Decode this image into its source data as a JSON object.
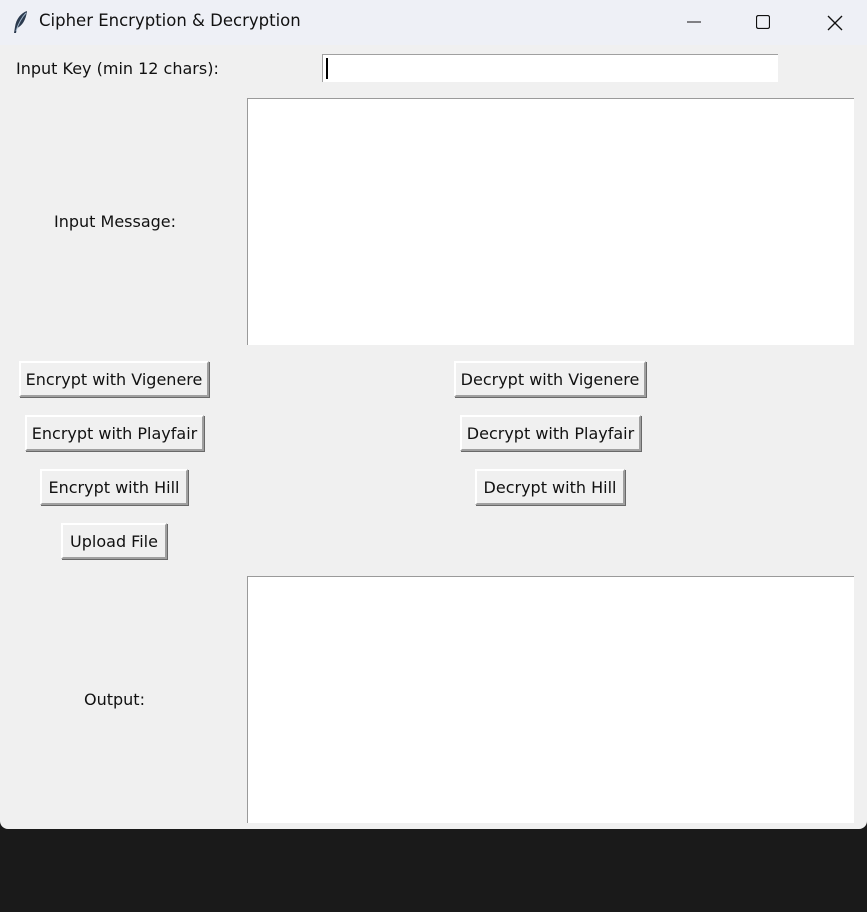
{
  "window": {
    "title": "Cipher Encryption & Decryption",
    "controls": {
      "minimize_icon": "minimize-icon",
      "maximize_icon": "maximize-icon",
      "close_icon": "close-icon"
    }
  },
  "form": {
    "key_label": "Input Key (min 12 chars):",
    "key_value": "",
    "message_label": "Input Message:",
    "message_value": "",
    "output_label": "Output:",
    "output_value": ""
  },
  "buttons": {
    "encrypt_vigenere": "Encrypt with Vigenere",
    "decrypt_vigenere": "Decrypt with Vigenere",
    "encrypt_playfair": "Encrypt with Playfair",
    "decrypt_playfair": "Decrypt with Playfair",
    "encrypt_hill": "Encrypt with Hill",
    "decrypt_hill": "Decrypt with Hill",
    "upload_file": "Upload File"
  },
  "colors": {
    "window_bg": "#f0f0f0",
    "titlebar_bg": "#eef0f6",
    "desktop_bg": "#1a1a1a",
    "field_bg": "#ffffff"
  }
}
